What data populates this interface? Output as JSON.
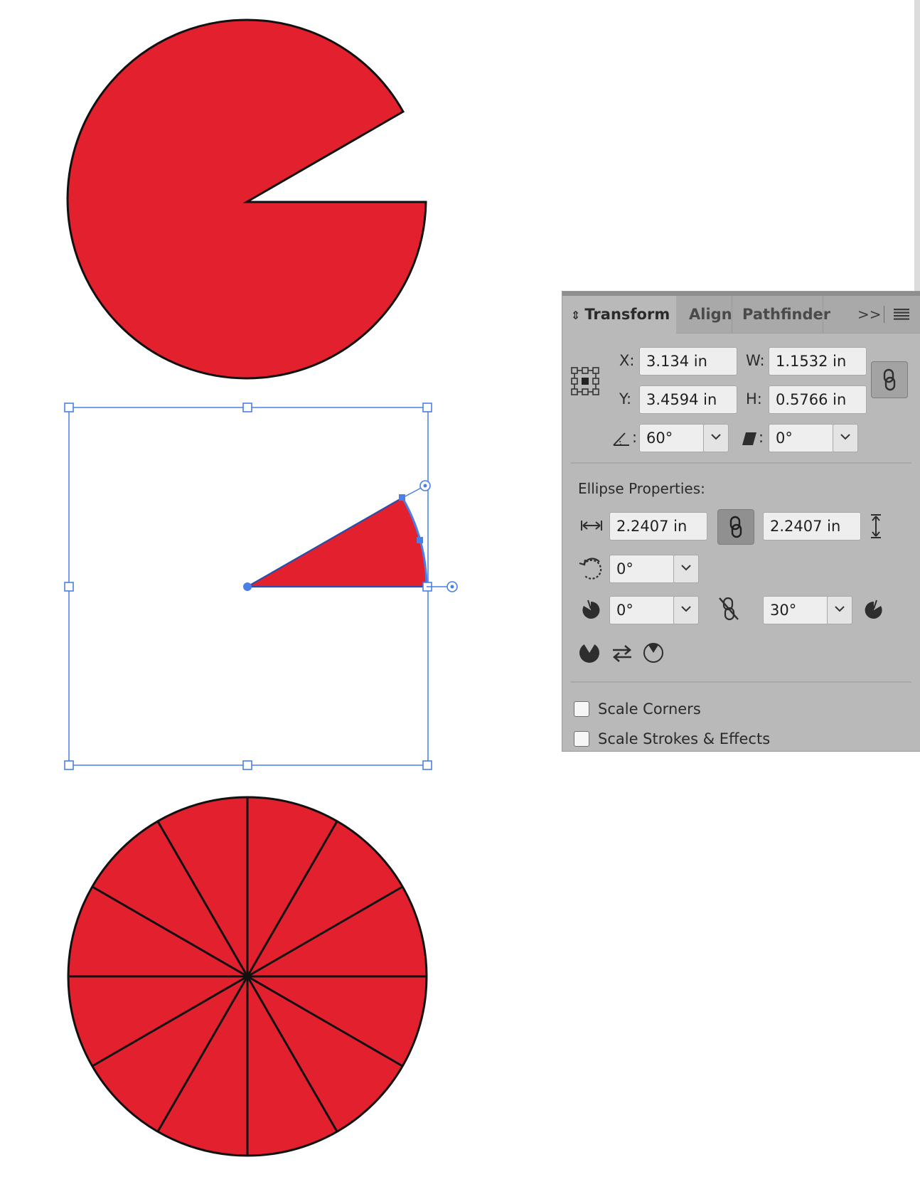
{
  "panel": {
    "tabs": [
      {
        "label": "Transform",
        "active": true
      },
      {
        "label": "Align",
        "active": false
      },
      {
        "label": "Pathfinder",
        "active": false
      }
    ],
    "overflow_glyph": ">>",
    "menu_icon": "hamburger-menu-icon",
    "transform": {
      "x_label": "X:",
      "x_value": "3.134 in",
      "w_label": "W:",
      "w_value": "1.1532 in",
      "y_label": "Y:",
      "y_value": "3.4594 in",
      "h_label": "H:",
      "h_value": "0.5766 in",
      "angle_label": ":",
      "angle_value": "60°",
      "shear_label": ":",
      "shear_value": "0°"
    },
    "ellipse": {
      "heading": "Ellipse Properties:",
      "width_value": "2.2407 in",
      "height_value": "2.2407 in",
      "rotation_value": "0°",
      "pie_start_value": "0°",
      "pie_end_value": "30°"
    },
    "options": [
      {
        "label": "Scale Corners",
        "checked": false
      },
      {
        "label": "Scale Strokes & Effects",
        "checked": false
      }
    ]
  },
  "colors": {
    "shape_fill": "#e2202e",
    "shape_stroke": "#111111",
    "selection": "#4a7fe6",
    "panel_bg": "#b9b9b9"
  }
}
